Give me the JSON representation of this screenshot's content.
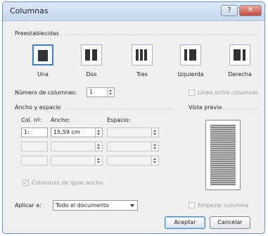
{
  "window": {
    "title": "Columnas",
    "help_label": "?",
    "close_label": "✕"
  },
  "presets": {
    "heading": "Preestablecidas",
    "items": [
      {
        "label": "Una"
      },
      {
        "label": "Dos"
      },
      {
        "label": "Tres"
      },
      {
        "label": "Izquierda"
      },
      {
        "label": "Derecha"
      }
    ]
  },
  "num_columns": {
    "label": "Número de columnas:",
    "value": "1"
  },
  "line_between": {
    "label": "Línea entre columnas"
  },
  "width_spacing": {
    "heading": "Ancho y espacio",
    "col_header": "Col. nº:",
    "width_header": "Ancho:",
    "spacing_header": "Espacio:",
    "rows": [
      {
        "col": "1:",
        "width": "15,59 cm",
        "spacing": ""
      },
      {
        "col": "",
        "width": "",
        "spacing": ""
      },
      {
        "col": "",
        "width": "",
        "spacing": ""
      }
    ]
  },
  "equal_width": {
    "label": "Columnas de igual ancho",
    "checked": true
  },
  "preview": {
    "label": "Vista previa"
  },
  "apply_to": {
    "label": "Aplicar a:",
    "value": "Todo el documento"
  },
  "new_column": {
    "label": "Empezar columna"
  },
  "buttons": {
    "ok": "Aceptar",
    "cancel": "Cancelar"
  },
  "colors": {
    "accent": "#3d7fd6",
    "close": "#c74b3b"
  }
}
